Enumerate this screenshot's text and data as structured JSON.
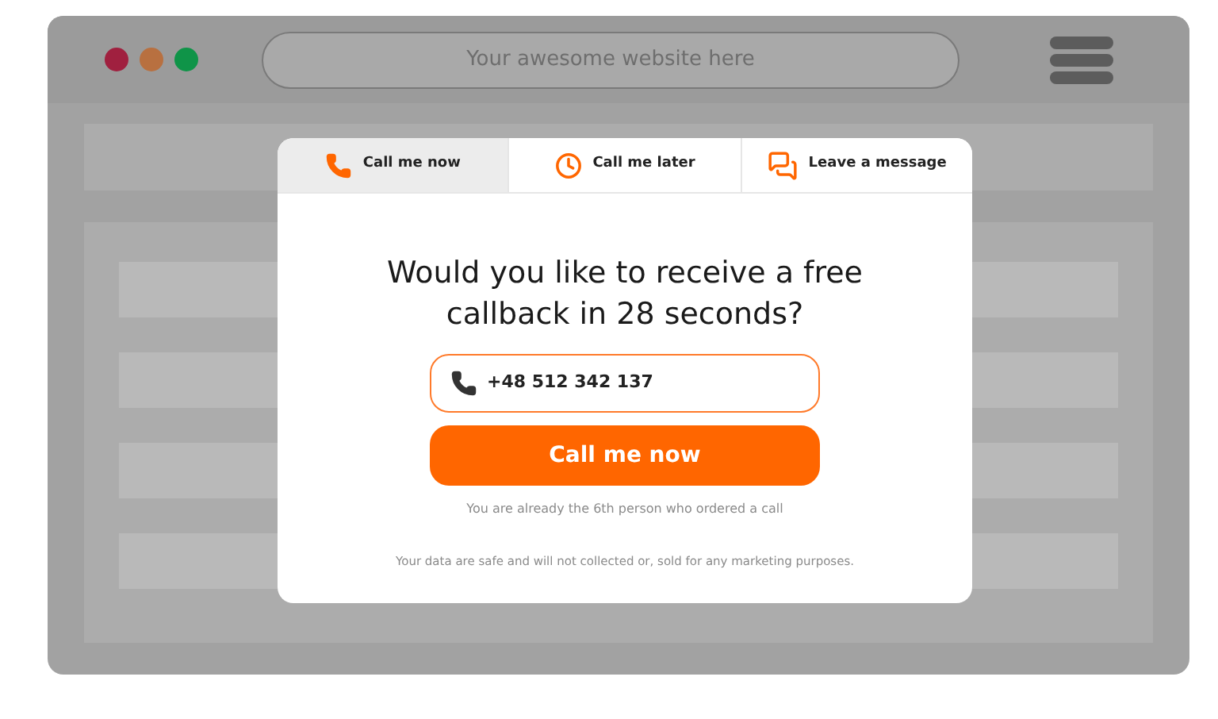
{
  "window": {
    "dots": [
      {
        "color": "#a0203f"
      },
      {
        "color": "#b87040"
      },
      {
        "color": "#0f9448"
      }
    ],
    "address": "Your awesome website here"
  },
  "popup": {
    "tabs": [
      {
        "label": "Call me now",
        "kind": "phone",
        "selected": true
      },
      {
        "label": "Call me later",
        "kind": "clock",
        "selected": false
      },
      {
        "label": "Leave a message",
        "kind": "message",
        "selected": false
      }
    ],
    "heading": "Would you like to receive a free callback in 28 seconds?",
    "phone": "+48 512 342 137",
    "button": "Call me now",
    "note": "You are already the 6th person who ordered a call",
    "disclaimer": "Your data are safe and will not collected or, sold for any marketing purposes."
  }
}
